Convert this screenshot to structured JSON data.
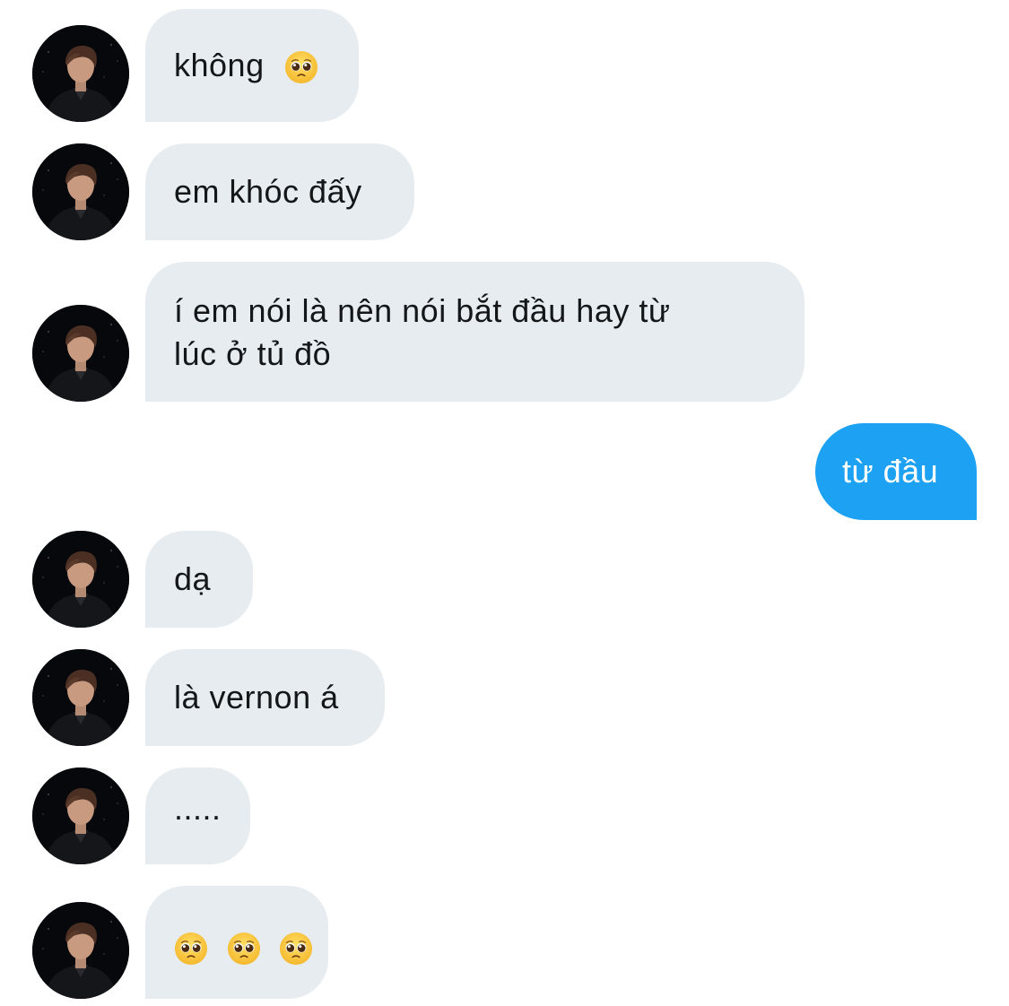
{
  "conversation": {
    "messages": [
      {
        "sender": "other",
        "text": "không",
        "emoji": [
          "pleading-face-emoji"
        ]
      },
      {
        "sender": "other",
        "text": "em khóc đấy"
      },
      {
        "sender": "other",
        "lines": [
          "í em nói là nên nói bắt đầu hay từ",
          "lúc ở tủ đồ"
        ]
      },
      {
        "sender": "me",
        "text": "từ đầu"
      },
      {
        "sender": "other",
        "text": "dạ"
      },
      {
        "sender": "other",
        "text": "là vernon á"
      },
      {
        "sender": "other",
        "text": "....."
      },
      {
        "sender": "other",
        "text": "",
        "emoji": [
          "pleading-face-emoji",
          "pleading-face-emoji",
          "pleading-face-emoji"
        ]
      }
    ]
  },
  "colors": {
    "incoming_bubble": "#e6ecf0",
    "outgoing_bubble": "#1da1f2",
    "incoming_text": "#14171a",
    "outgoing_text": "#ffffff"
  },
  "icons": {
    "avatar": "profile-photo",
    "emoji": "pleading-face-emoji"
  }
}
